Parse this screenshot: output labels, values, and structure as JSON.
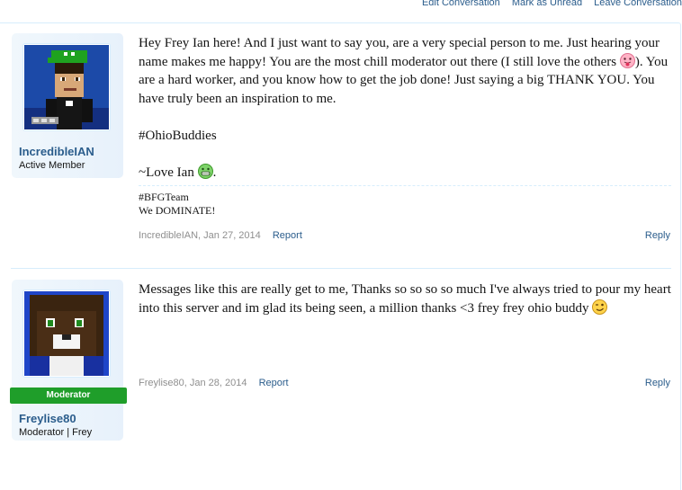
{
  "top_links": [
    "Edit Conversation",
    "Mark as Unread",
    "Leave Conversation"
  ],
  "messages": [
    {
      "username": "IncredibleIAN",
      "user_title": "Active Member",
      "paragraphs": [
        "Hey Frey Ian here! And I just want to say you, are a very special person to me. Just hearing your name makes me happy! You are the most chill moderator out there (I still love the others ",
        "). You are a hard worker, and you know how to get the job done! Just saying a big THANK YOU. You have truly been an inspiration to me.",
        "#OhioBuddies",
        "~Love Ian ",
        "."
      ],
      "signature": [
        "#BFGTeam",
        "We DOMINATE!"
      ],
      "author": "IncredibleIAN",
      "date": "Jan 27, 2014",
      "report_label": "Report",
      "reply_label": "Reply"
    },
    {
      "username": "Freylise80",
      "ribbon": "Moderator",
      "user_title": "Moderator | Frey",
      "paragraphs": [
        "Messages like this are really get to me, Thanks so so so so much I've always tried to pour my heart into this server and im glad its being seen, a million thanks <3 frey frey ohio buddy "
      ],
      "author": "Freylise80",
      "date": "Jan 28, 2014",
      "report_label": "Report",
      "reply_label": "Reply"
    }
  ],
  "icons": [
    "tongue-emoji-icon",
    "grin-emoji-icon",
    "wink-emoji-icon"
  ],
  "colors": {
    "link": "#2b5d8c",
    "userbox": "#e7f1fb",
    "border": "#d7edfc",
    "moderator": "#1f9e2a"
  }
}
